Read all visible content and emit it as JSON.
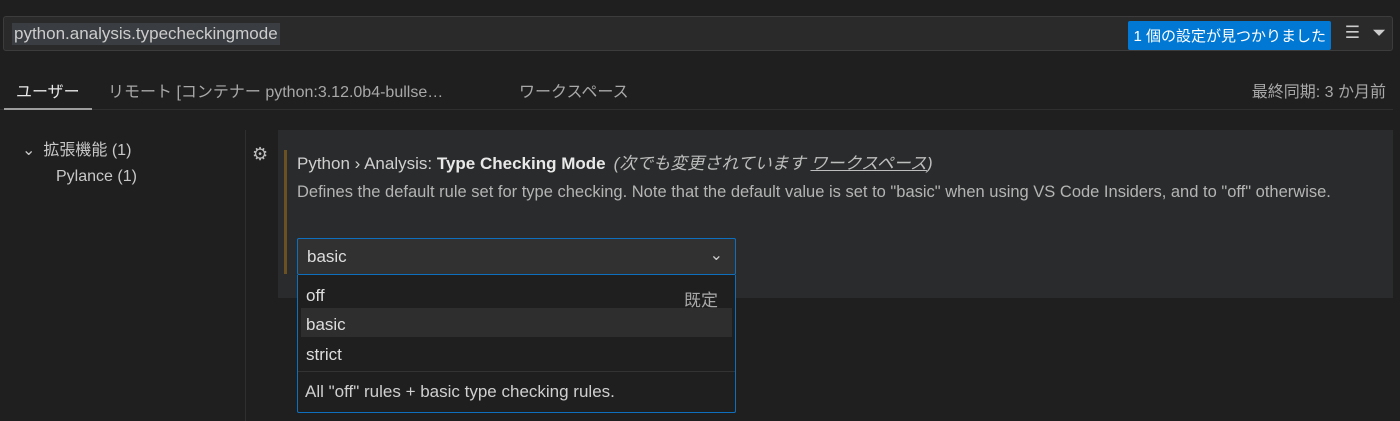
{
  "search": {
    "query": "python.analysis.typecheckingmode",
    "result_badge": "1 個の設定が見つかりました"
  },
  "tabs": [
    {
      "label": "ユーザー"
    },
    {
      "label": "リモート [コンテナー python:3.12.0b4-bullse…"
    },
    {
      "label": "ワークスペース"
    }
  ],
  "last_sync": "最終同期: 3 か月前",
  "tree": {
    "group": "拡張機能 (1)",
    "child": "Pylance (1)"
  },
  "setting": {
    "category": "Python › Analysis: ",
    "name": "Type Checking Mode",
    "modified_prefix": "(次でも変更されています ",
    "modified_link": "ワークスペース",
    "modified_suffix": ")",
    "description": "Defines the default rule set for type checking. Note that the default value is set to \"basic\" when using VS Code Insiders, and to \"off\" otherwise.",
    "value": "basic",
    "options": [
      {
        "label": "off",
        "tag": "既定"
      },
      {
        "label": "basic"
      },
      {
        "label": "strict"
      }
    ],
    "option_hint": "All \"off\" rules + basic type checking rules."
  }
}
